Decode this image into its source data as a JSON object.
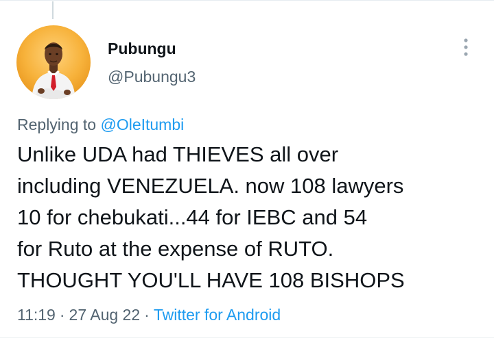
{
  "user": {
    "name": "Pubungu",
    "handle": "@Pubungu3"
  },
  "reply": {
    "prefix": "Replying to ",
    "mention": "@OleItumbi"
  },
  "tweet": {
    "lines": [
      "Unlike UDA had THIEVES all over",
      "including VENEZUELA. now 108 lawyers",
      "10 for chebukati...44 for IEBC and 54",
      "for Ruto at the expense of RUTO.",
      "THOUGHT YOU'LL HAVE 108 BISHOPS"
    ]
  },
  "meta": {
    "time": "11:19",
    "separator": "·",
    "date": "27 Aug 22",
    "source": "Twitter for Android"
  },
  "icons": {
    "more": "more-vertical-icon",
    "avatar": "profile-photo"
  },
  "colors": {
    "accent": "#1d9bf0",
    "text": "#0f1419",
    "secondary": "#536471",
    "avatar_bg": "#f5a623"
  }
}
